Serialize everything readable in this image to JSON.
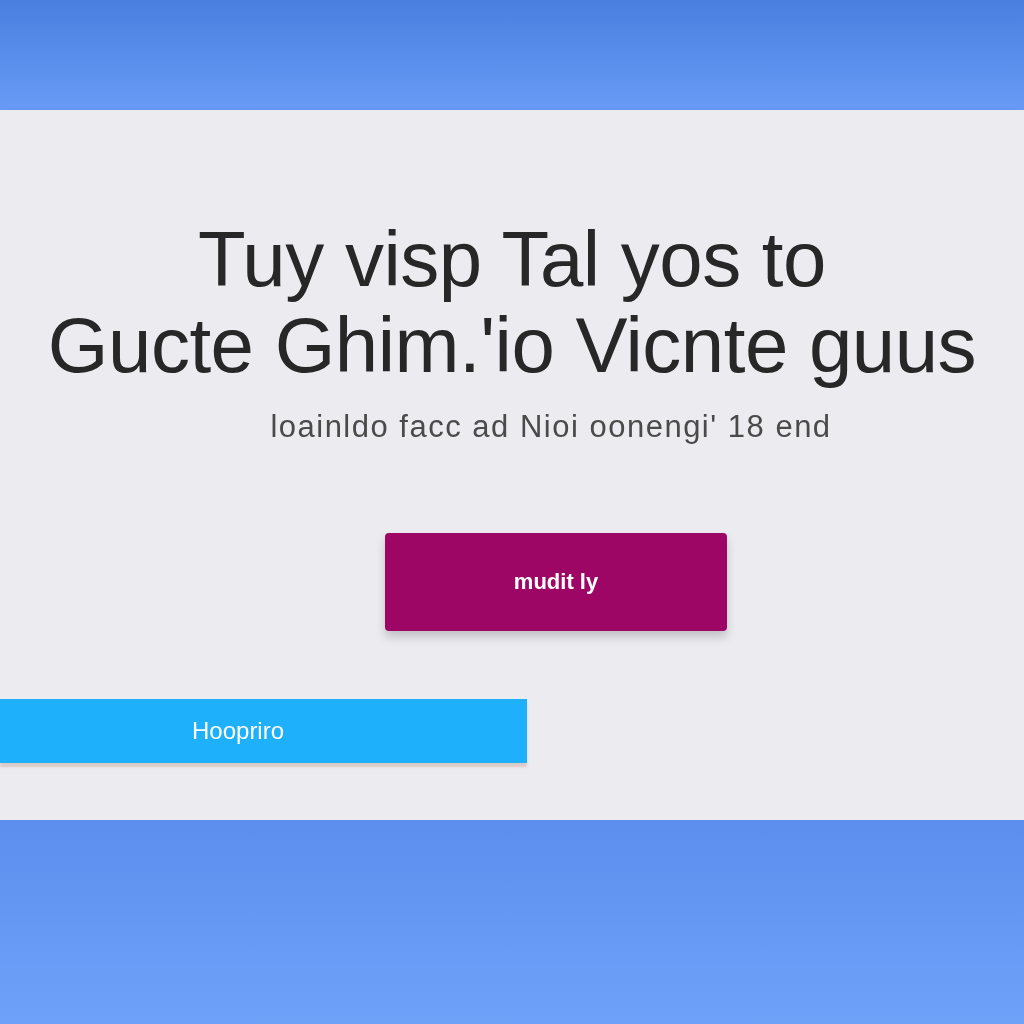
{
  "heading": {
    "lines": [
      "Tuy visp Tal yos to",
      "Gucte Ghim.'io Vicnte guus"
    ]
  },
  "subtitle": "loainldo facc ad Nioi oonengi' 18 end",
  "buttons": [
    {
      "kind": "primary",
      "label": "mudit ly"
    },
    {
      "kind": "bar",
      "label": "Hoopriro"
    }
  ]
}
